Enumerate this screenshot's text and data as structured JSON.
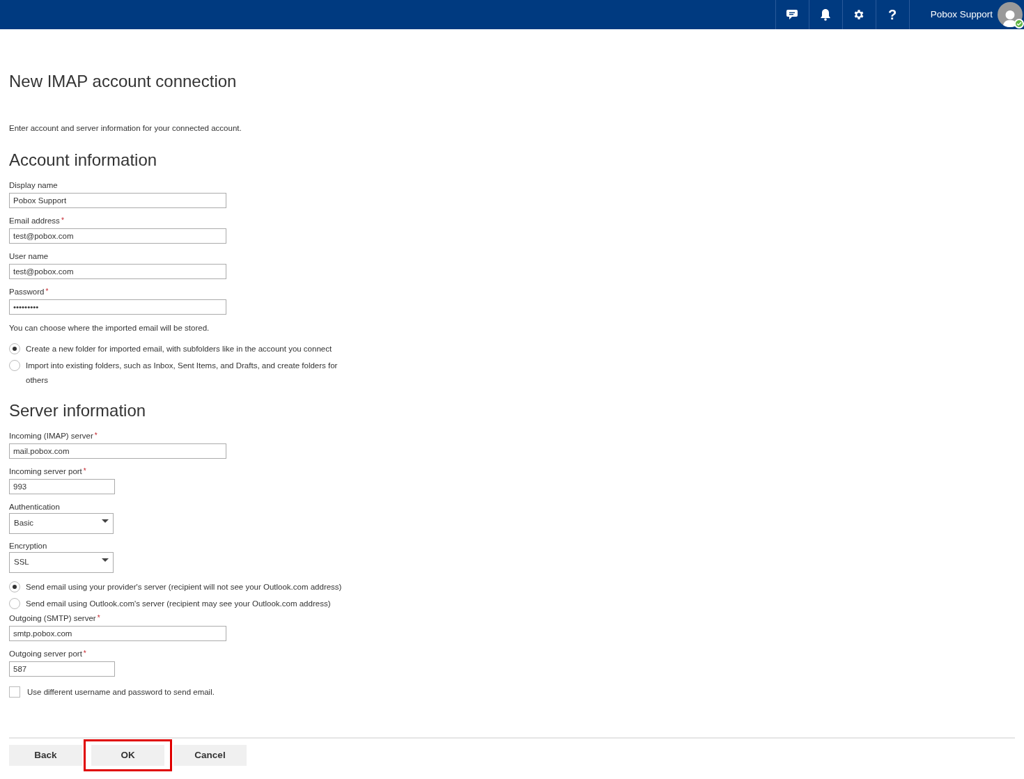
{
  "top_bar": {
    "icons": [
      {
        "kind": "chat"
      },
      {
        "kind": "bell"
      },
      {
        "kind": "gear"
      },
      {
        "kind": "help",
        "label": "?"
      }
    ],
    "user": {
      "name": "Pobox Support",
      "online": true
    }
  },
  "page": {
    "title": "New IMAP account connection",
    "intro": "Enter account and server information for your connected account."
  },
  "sections": [
    {
      "heading": "Account information",
      "items": [
        {
          "kind": "text",
          "label": "Display name",
          "value": "Pobox Support",
          "wide": true
        },
        {
          "kind": "text",
          "label": "Email address",
          "required_mark": "*",
          "value": "test@pobox.com",
          "wide": true
        },
        {
          "kind": "text",
          "label": "User name",
          "value": "test@pobox.com",
          "wide": true
        },
        {
          "kind": "text",
          "label": "Password",
          "required_mark": "*",
          "value": "•••••••••",
          "wide": true
        },
        {
          "kind": "note",
          "text": "You can choose where the imported email will be stored."
        },
        {
          "kind": "radio",
          "label": "Create a new folder for imported email, with subfolders like in the account you connect",
          "selected": true
        },
        {
          "kind": "radio",
          "label": "Import into existing folders, such as Inbox, Sent Items, and Drafts, and create folders for others",
          "selected": false
        }
      ]
    },
    {
      "heading": "Server information",
      "items": [
        {
          "kind": "text",
          "label": "Incoming (IMAP) server",
          "required_mark": "*",
          "value": "mail.pobox.com",
          "wide": true
        },
        {
          "kind": "text",
          "label": "Incoming server port",
          "required_mark": "*",
          "value": "993",
          "wide": false
        },
        {
          "kind": "select",
          "label": "Authentication",
          "value": "Basic"
        },
        {
          "kind": "select",
          "label": "Encryption",
          "value": "SSL"
        },
        {
          "kind": "radio",
          "label": "Send email using your provider's server (recipient will not see your Outlook.com address)",
          "selected": true
        },
        {
          "kind": "radio",
          "label": "Send email using Outlook.com's server (recipient may see your Outlook.com address)",
          "selected": false
        },
        {
          "kind": "text",
          "label": "Outgoing (SMTP) server",
          "required_mark": "*",
          "value": "smtp.pobox.com",
          "wide": true
        },
        {
          "kind": "text",
          "label": "Outgoing server port",
          "required_mark": "*",
          "value": "587",
          "wide": false
        },
        {
          "kind": "checkbox",
          "label": "Use different username and password to send email.",
          "checked": false
        }
      ]
    }
  ],
  "buttons": [
    {
      "label": "Back",
      "highlighted": false
    },
    {
      "label": "OK",
      "highlighted": true
    },
    {
      "label": "Cancel",
      "highlighted": false
    }
  ]
}
